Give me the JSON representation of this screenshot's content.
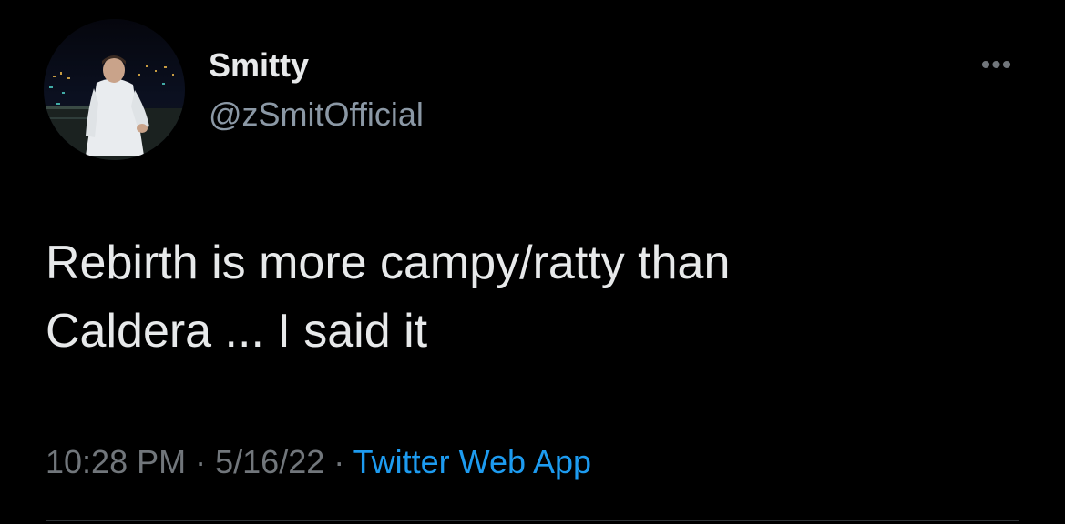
{
  "tweet": {
    "author": {
      "display_name": "Smitty",
      "handle": "@zSmitOfficial"
    },
    "more_icon": "more-horizontal-icon",
    "text_lines": [
      "Rebirth is more campy/ratty than",
      "Caldera ... I said it"
    ],
    "time": "10:28 PM",
    "separator": "·",
    "date": "5/16/22",
    "source": "Twitter Web App"
  },
  "colors": {
    "background": "#000000",
    "primary_text": "#e7e9ea",
    "secondary_text": "#71767b",
    "link": "#1d9bf0"
  }
}
